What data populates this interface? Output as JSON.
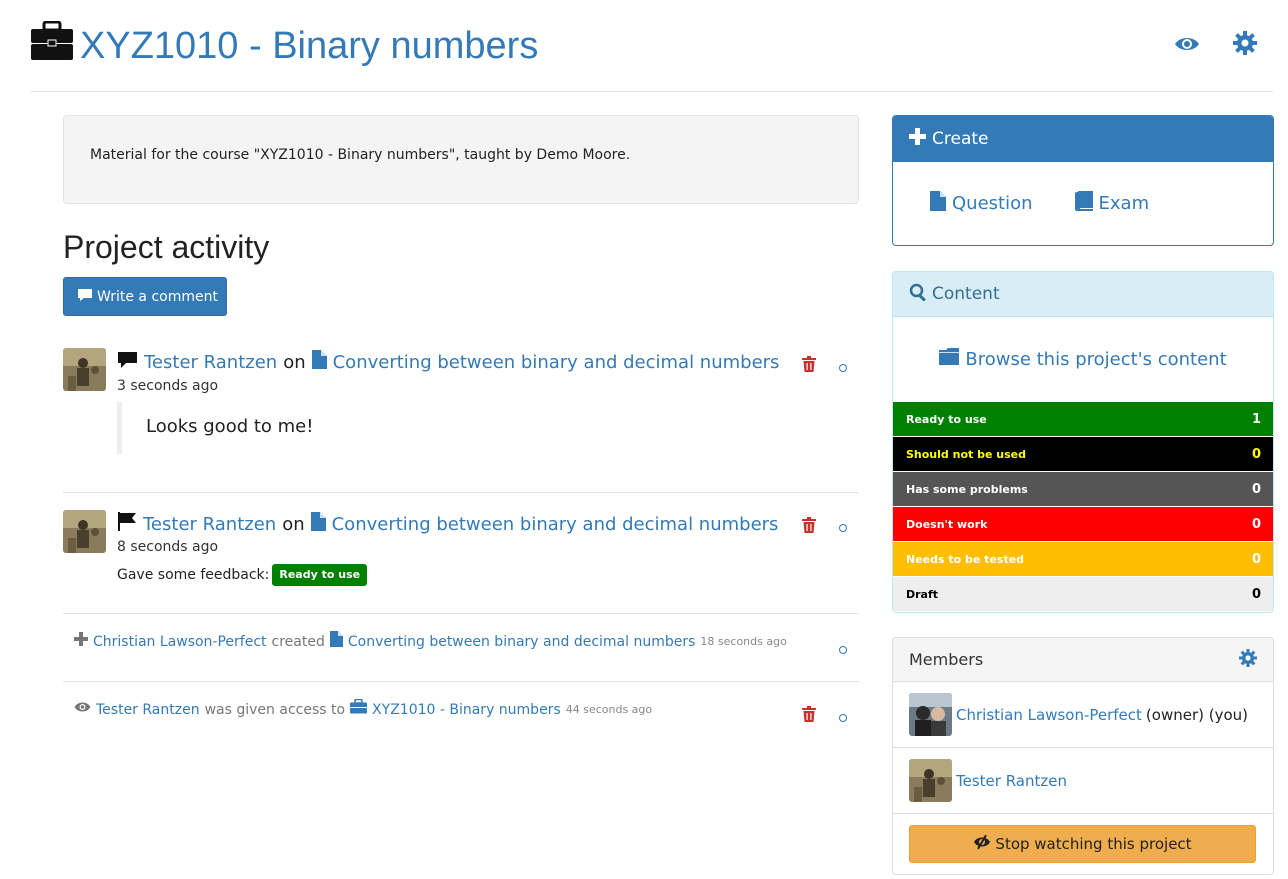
{
  "header": {
    "title": "XYZ1010 - Binary numbers",
    "icons": [
      "briefcase-icon",
      "eye-icon",
      "gear-icon"
    ]
  },
  "description": "Material for the course \"XYZ1010 - Binary numbers\", taught by Demo Moore.",
  "activity": {
    "heading": "Project activity",
    "write_comment_label": "Write a comment",
    "items": [
      {
        "icon": "comment-icon",
        "user": "Tester Rantzen",
        "on": "on",
        "target": "Converting between binary and decimal numbers",
        "time": "3 seconds ago",
        "comment": "Looks good to me!"
      },
      {
        "icon": "flag-icon",
        "user": "Tester Rantzen",
        "on": "on",
        "target": "Converting between binary and decimal numbers",
        "time": "8 seconds ago",
        "feedback_prefix": "Gave some feedback:",
        "feedback_badge": "Ready to use"
      },
      {
        "icon": "plus-icon",
        "user": "Christian Lawson-Perfect",
        "verb": "created",
        "target": "Converting between binary and decimal numbers",
        "time": "18 seconds ago"
      },
      {
        "icon": "eye-icon",
        "user": "Tester Rantzen",
        "verb": "was given access to",
        "target": "XYZ1010 - Binary numbers",
        "time": "44 seconds ago"
      }
    ]
  },
  "create_panel": {
    "title": "Create",
    "question_label": "Question",
    "exam_label": "Exam"
  },
  "content_panel": {
    "title": "Content",
    "browse_label": "Browse this project's content",
    "statuses": [
      {
        "label": "Ready to use",
        "count": "1",
        "bg": "#008000",
        "fg": "#ffffff"
      },
      {
        "label": "Should not be used",
        "count": "0",
        "bg": "#000000",
        "fg": "#ffff00"
      },
      {
        "label": "Has some problems",
        "count": "0",
        "bg": "#555555",
        "fg": "#ffffff"
      },
      {
        "label": "Doesn't work",
        "count": "0",
        "bg": "#ff0000",
        "fg": "#ffffff"
      },
      {
        "label": "Needs to be tested",
        "count": "0",
        "bg": "#ffbf00",
        "fg": "#ffffff"
      },
      {
        "label": "Draft",
        "count": "0",
        "bg": "#eeeeee",
        "fg": "#000000"
      }
    ]
  },
  "members_panel": {
    "title": "Members",
    "members": [
      {
        "name": "Christian Lawson-Perfect",
        "suffix": "(owner) (you)"
      },
      {
        "name": "Tester Rantzen",
        "suffix": ""
      }
    ],
    "stop_watching_label": "Stop watching this project"
  },
  "colors": {
    "link": "#337ab7",
    "primary": "#337ab7",
    "info_bg": "#d9edf7",
    "warning": "#f0ad4e",
    "danger": "#c9302c"
  }
}
